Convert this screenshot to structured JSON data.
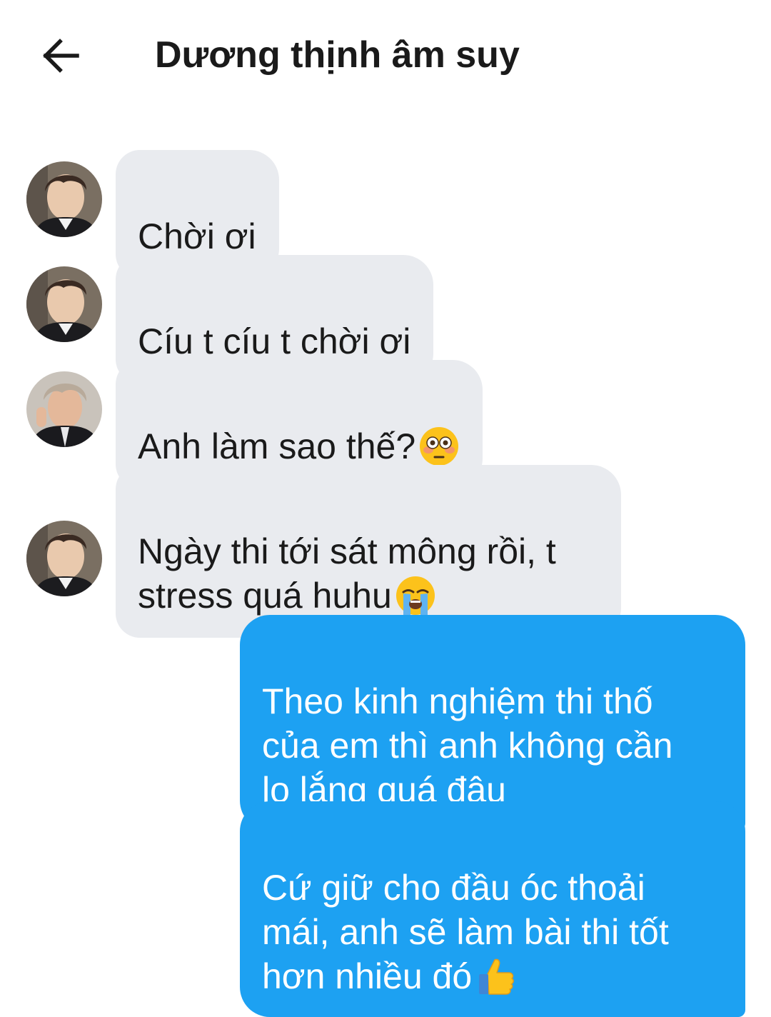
{
  "header": {
    "back_icon": "arrow-left-icon",
    "title": "Dương thịnh âm suy"
  },
  "messages": [
    {
      "direction": "incoming",
      "sender_avatar": "avatar-1",
      "text": "Chời ơi"
    },
    {
      "direction": "incoming",
      "sender_avatar": "avatar-1",
      "text": "Cíu t cíu t chời ơi"
    },
    {
      "direction": "incoming",
      "sender_avatar": "avatar-2",
      "text": "Anh làm sao thế?",
      "emoji": "flushed-face-emoji"
    },
    {
      "direction": "incoming",
      "sender_avatar": "avatar-1",
      "text": "Ngày thi tới sát mông rồi, t\nstress quá huhu",
      "emoji": "loudly-crying-face-emoji"
    },
    {
      "direction": "outgoing",
      "text": "Theo kinh nghiệm thi thố\ncủa em thì anh không cần\nlo lắng quá đâu"
    },
    {
      "direction": "outgoing",
      "text": "Cứ giữ cho đầu óc thoải\nmái, anh sẽ làm bài thi tốt\nhơn nhiều đó",
      "emoji": "thumbs-up-emoji"
    }
  ],
  "colors": {
    "incoming_bubble": "#e9ebef",
    "outgoing_bubble": "#1da1f2",
    "outgoing_text": "#ffffff",
    "text": "#1a1a1a"
  }
}
